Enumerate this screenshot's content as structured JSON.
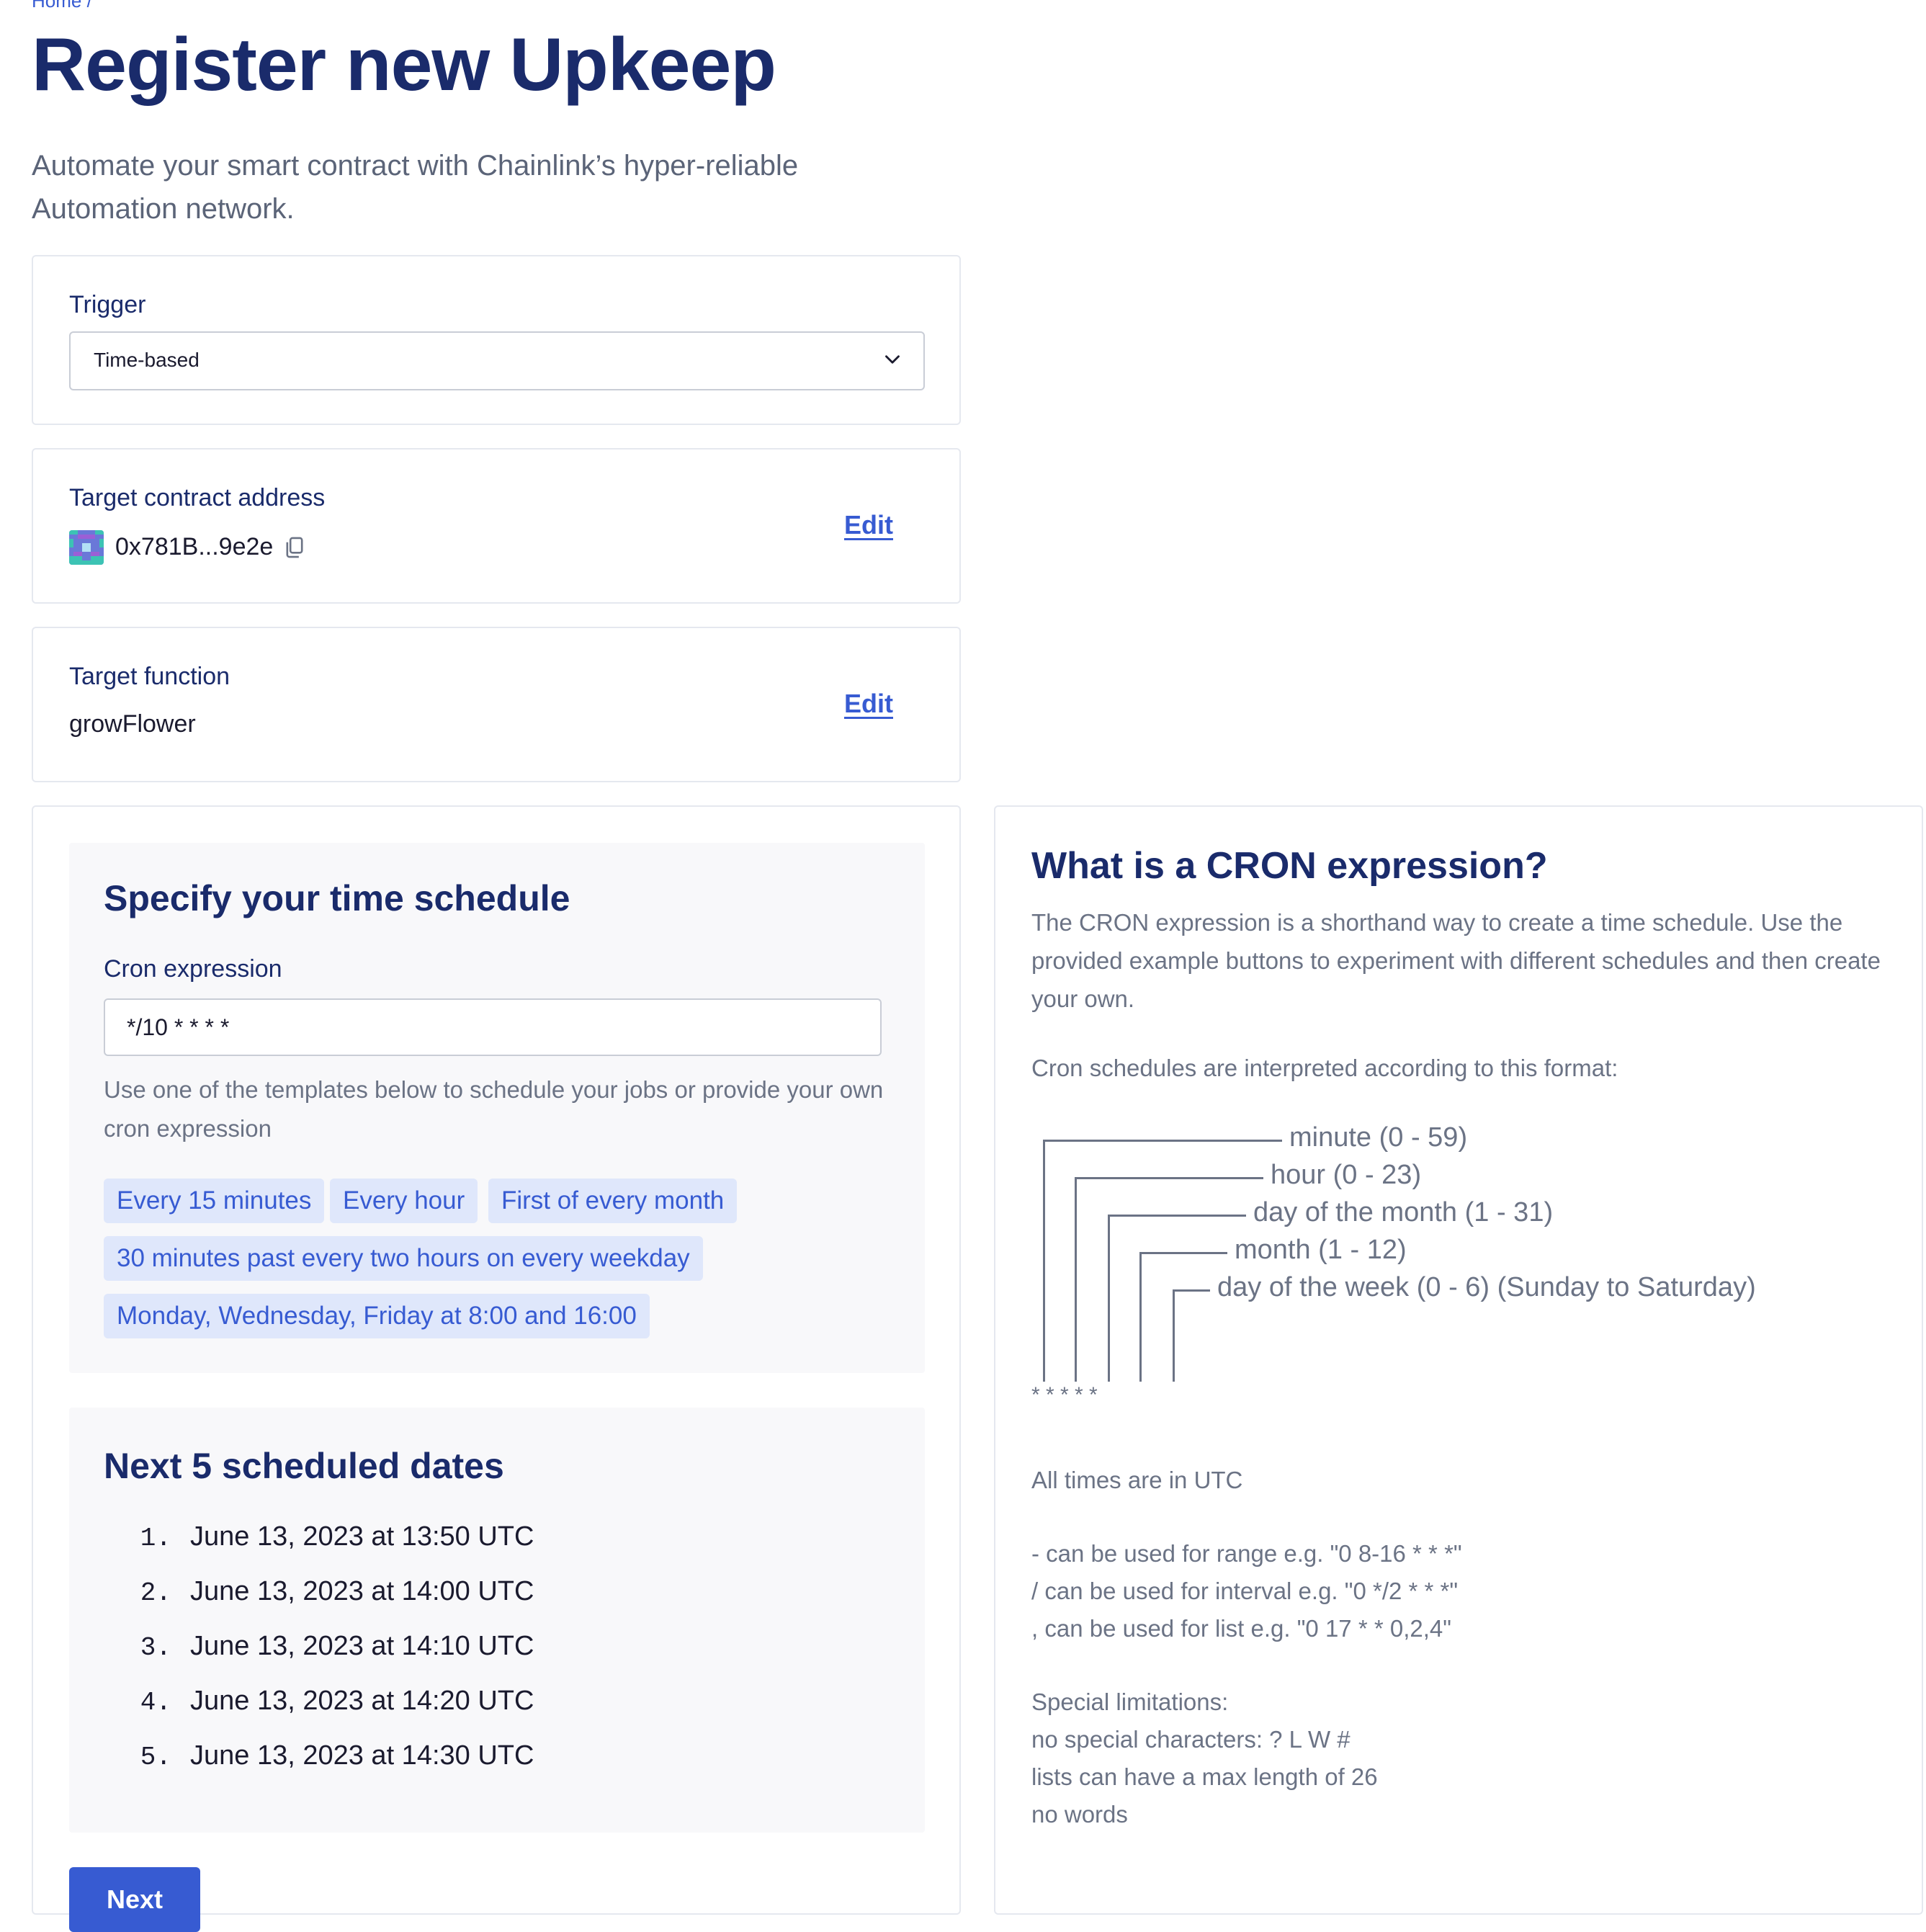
{
  "breadcrumb": "Home /",
  "page_title": "Register new Upkeep",
  "page_subtitle": "Automate your smart contract with Chainlink’s hyper-reliable Automation network.",
  "trigger": {
    "label": "Trigger",
    "selected": "Time-based"
  },
  "target_contract": {
    "label": "Target contract address",
    "address": "0x781B...9e2e",
    "edit_label": "Edit"
  },
  "target_function": {
    "label": "Target function",
    "value": "growFlower",
    "edit_label": "Edit"
  },
  "schedule": {
    "title": "Specify your time schedule",
    "cron_label": "Cron expression",
    "cron_value": "*/10 * * * *",
    "helper": "Use one of the templates below to schedule your jobs or provide your own cron expression",
    "templates": [
      "Every 15 minutes",
      "Every hour",
      "First of every month",
      "30 minutes past every two hours on every weekday",
      "Monday, Wednesday, Friday at 8:00 and 16:00"
    ]
  },
  "next_dates": {
    "title": "Next 5 scheduled dates",
    "items": [
      {
        "num": "1.",
        "text": "June 13, 2023 at 13:50 UTC"
      },
      {
        "num": "2.",
        "text": "June 13, 2023 at 14:00 UTC"
      },
      {
        "num": "3.",
        "text": "June 13, 2023 at 14:10 UTC"
      },
      {
        "num": "4.",
        "text": "June 13, 2023 at 14:20 UTC"
      },
      {
        "num": "5.",
        "text": "June 13, 2023 at 14:30 UTC"
      }
    ]
  },
  "next_button": "Next",
  "cron_info": {
    "title": "What is a CRON expression?",
    "intro": "The CRON expression is a shorthand way to create a time schedule. Use the provided example buttons to experiment with different schedules and then create your own.",
    "format_intro": "Cron schedules are interpreted according to this format:",
    "fields": [
      "minute (0 - 59)",
      "hour (0 - 23)",
      "day of the month (1 - 31)",
      "month (1 - 12)",
      "day of the week (0 - 6) (Sunday to Saturday)"
    ],
    "stars": "* * * * *",
    "utc_note": "All times are in UTC",
    "range_note": "- can be used for range e.g. \"0 8-16 * * *\"",
    "interval_note": "/ can be used for interval e.g. \"0 */2 * * *\"",
    "list_note": ", can be used for list e.g. \"0 17 * * 0,2,4\"",
    "limitations_title": "Special limitations:",
    "limitations": [
      "no special characters: ? L W #",
      "lists can have a max length of 26",
      "no words"
    ]
  },
  "colors": {
    "primary": "#375bd2",
    "heading": "#1a2b6b",
    "chip_bg": "#dfe7fb",
    "panel_bg": "#f8f8fa",
    "muted_text": "#6b7385"
  }
}
